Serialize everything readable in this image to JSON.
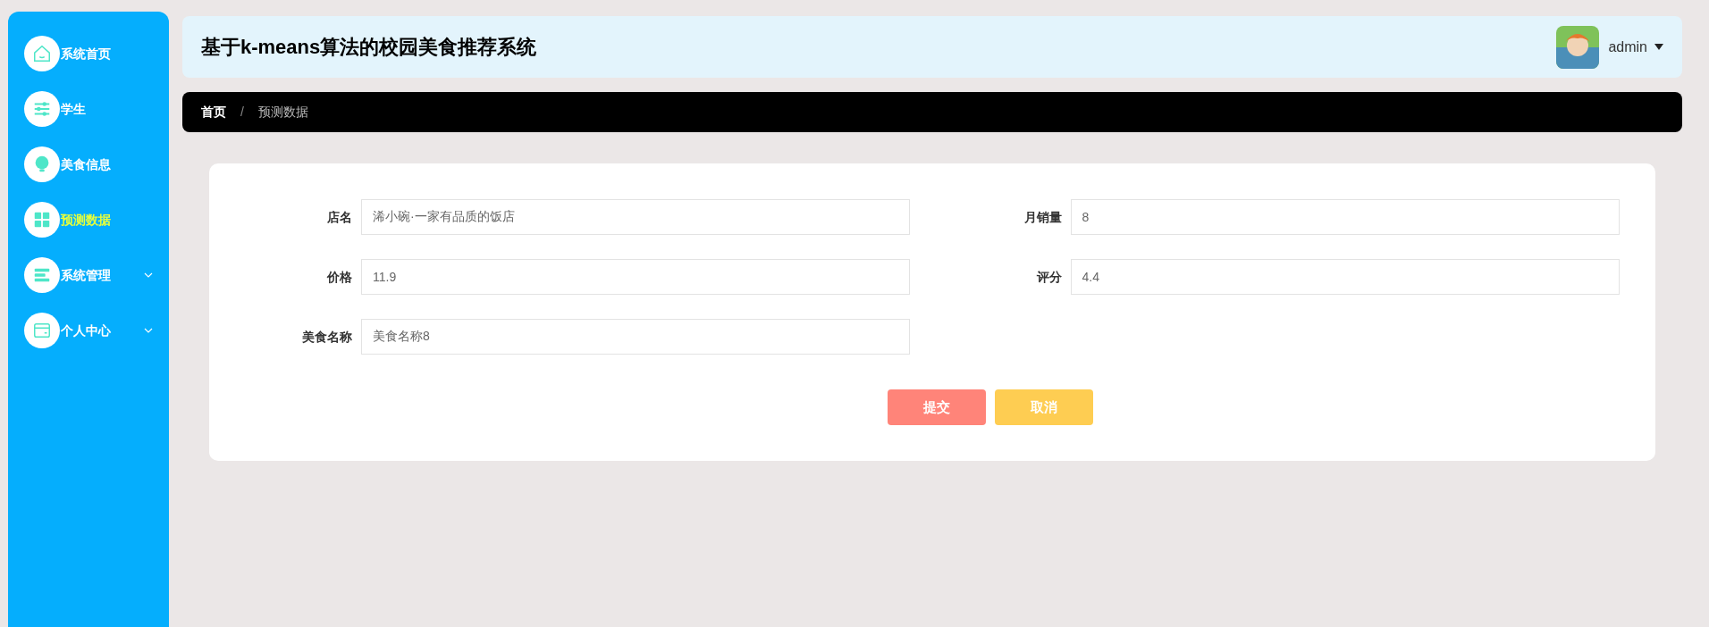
{
  "sidebar": {
    "items": [
      {
        "label": "系统首页",
        "kind": "link",
        "selected": false
      },
      {
        "label": "学生",
        "kind": "link",
        "selected": false
      },
      {
        "label": "美食信息",
        "kind": "link",
        "selected": false
      },
      {
        "label": "预测数据",
        "kind": "link",
        "selected": true
      },
      {
        "label": "系统管理",
        "kind": "group",
        "selected": false,
        "expanded": false
      },
      {
        "label": "个人中心",
        "kind": "group",
        "selected": false,
        "expanded": false
      }
    ]
  },
  "header": {
    "title": "基于k-means算法的校园美食推荐系统",
    "user": "admin"
  },
  "breadcrumb": [
    "首页",
    "预测数据"
  ],
  "breadcrumb_separator": "/",
  "form": {
    "fields": [
      {
        "label": "店名",
        "value": "浠小碗·一家有品质的饭店"
      },
      {
        "label": "月销量",
        "value": "8"
      },
      {
        "label": "价格",
        "value": "11.9"
      },
      {
        "label": "评分",
        "value": "4.4"
      },
      {
        "label": "美食名称",
        "value": "美食名称8"
      }
    ],
    "buttons": [
      {
        "label": "提交",
        "kind": "primary"
      },
      {
        "label": "取消",
        "kind": "cancel"
      }
    ]
  }
}
